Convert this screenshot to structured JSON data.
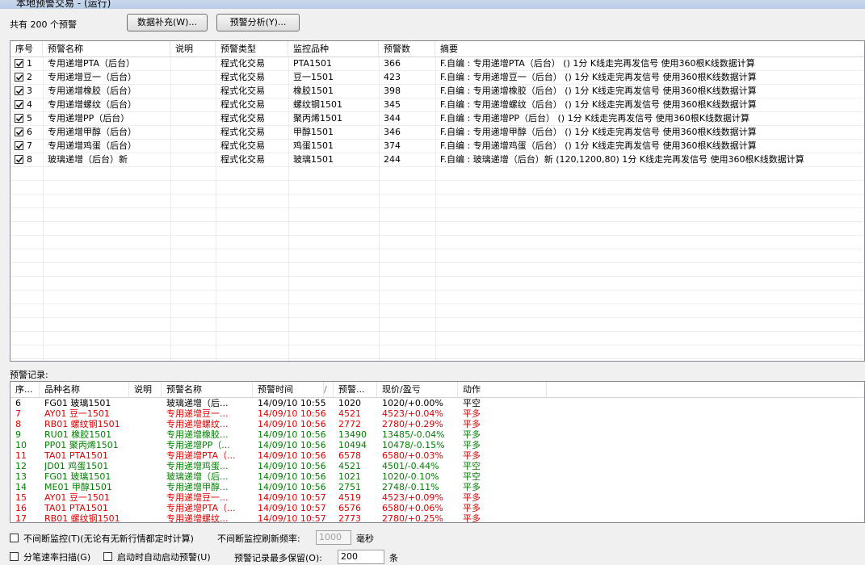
{
  "window": {
    "title": "本地预警交易 - (运行)"
  },
  "toolbar": {
    "count_text": "共有 200 个预警",
    "data_supplement_label": "数据补充(W)...",
    "alert_analysis_label": "预警分析(Y)..."
  },
  "alerts_table": {
    "columns": [
      "序号",
      "预警名称",
      "说明",
      "预警类型",
      "监控品种",
      "预警数",
      "摘要"
    ],
    "rows": [
      {
        "checked": true,
        "no": "1",
        "name": "专用递增PTA（后台）",
        "desc": "",
        "type": "程式化交易",
        "symbol": "PTA1501",
        "count": "366",
        "summary": "F.自编 : 专用递增PTA（后台） () 1分 K线走完再发信号 使用360根K线数据计算"
      },
      {
        "checked": true,
        "no": "2",
        "name": "专用递增豆一（后台）",
        "desc": "",
        "type": "程式化交易",
        "symbol": "豆一1501",
        "count": "423",
        "summary": "F.自编 : 专用递增豆一（后台） () 1分 K线走完再发信号 使用360根K线数据计算"
      },
      {
        "checked": true,
        "no": "3",
        "name": "专用递增橡胶（后台）",
        "desc": "",
        "type": "程式化交易",
        "symbol": "橡胶1501",
        "count": "398",
        "summary": "F.自编 : 专用递增橡胶（后台） () 1分 K线走完再发信号 使用360根K线数据计算"
      },
      {
        "checked": true,
        "no": "4",
        "name": "专用递增螺纹（后台）",
        "desc": "",
        "type": "程式化交易",
        "symbol": "螺纹钢1501",
        "count": "345",
        "summary": "F.自编 : 专用递增螺纹（后台） () 1分 K线走完再发信号 使用360根K线数据计算"
      },
      {
        "checked": true,
        "no": "5",
        "name": "专用递增PP（后台）",
        "desc": "",
        "type": "程式化交易",
        "symbol": "聚丙烯1501",
        "count": "344",
        "summary": "F.自编 : 专用递增PP（后台） () 1分 K线走完再发信号 使用360根K线数据计算"
      },
      {
        "checked": true,
        "no": "6",
        "name": "专用递增甲醇（后台）",
        "desc": "",
        "type": "程式化交易",
        "symbol": "甲醇1501",
        "count": "346",
        "summary": "F.自编 : 专用递增甲醇（后台） () 1分 K线走完再发信号 使用360根K线数据计算"
      },
      {
        "checked": true,
        "no": "7",
        "name": "专用递增鸡蛋（后台）",
        "desc": "",
        "type": "程式化交易",
        "symbol": "鸡蛋1501",
        "count": "374",
        "summary": "F.自编 : 专用递增鸡蛋（后台） () 1分 K线走完再发信号 使用360根K线数据计算"
      },
      {
        "checked": true,
        "no": "8",
        "name": "玻璃递增（后台）新",
        "desc": "",
        "type": "程式化交易",
        "symbol": "玻璃1501",
        "count": "244",
        "summary": "F.自编 : 玻璃递增（后台）新 (120,1200,80) 1分 K线走完再发信号 使用360根K线数据计算"
      }
    ]
  },
  "records": {
    "label": "预警记录:",
    "columns": [
      "序...",
      "品种名称",
      "说明",
      "预警名称",
      "预警时间",
      "/",
      "预警...",
      "现价/盈亏",
      "动作"
    ],
    "rows": [
      {
        "no": "6",
        "symbol": "FG01 玻璃1501",
        "desc": "",
        "name": "玻璃递增（后...",
        "time": "14/09/10 10:55",
        "price": "1020",
        "pnl": "1020/+0.00%",
        "action": "平空",
        "color": "#000000"
      },
      {
        "no": "7",
        "symbol": "AY01 豆一1501",
        "desc": "",
        "name": "专用递增豆一...",
        "time": "14/09/10 10:56",
        "price": "4521",
        "pnl": "4523/+0.04%",
        "action": "平多",
        "color": "#e00000"
      },
      {
        "no": "8",
        "symbol": "RB01 螺纹钢1501",
        "desc": "",
        "name": "专用递增螺纹...",
        "time": "14/09/10 10:56",
        "price": "2772",
        "pnl": "2780/+0.29%",
        "action": "平多",
        "color": "#e00000"
      },
      {
        "no": "9",
        "symbol": "RU01 橡胶1501",
        "desc": "",
        "name": "专用递增橡胶...",
        "time": "14/09/10 10:56",
        "price": "13490",
        "pnl": "13485/-0.04%",
        "action": "平多",
        "color": "#008000"
      },
      {
        "no": "10",
        "symbol": "PP01 聚丙烯1501",
        "desc": "",
        "name": "专用递增PP（...",
        "time": "14/09/10 10:56",
        "price": "10494",
        "pnl": "10478/-0.15%",
        "action": "平多",
        "color": "#008000"
      },
      {
        "no": "11",
        "symbol": "TA01 PTA1501",
        "desc": "",
        "name": "专用递增PTA（...",
        "time": "14/09/10 10:56",
        "price": "6578",
        "pnl": "6580/+0.03%",
        "action": "平多",
        "color": "#e00000"
      },
      {
        "no": "12",
        "symbol": "JD01 鸡蛋1501",
        "desc": "",
        "name": "专用递增鸡蛋...",
        "time": "14/09/10 10:56",
        "price": "4521",
        "pnl": "4501/-0.44%",
        "action": "平空",
        "color": "#008000"
      },
      {
        "no": "13",
        "symbol": "FG01 玻璃1501",
        "desc": "",
        "name": "玻璃递增（后...",
        "time": "14/09/10 10:56",
        "price": "1021",
        "pnl": "1020/-0.10%",
        "action": "平空",
        "color": "#008000"
      },
      {
        "no": "14",
        "symbol": "ME01 甲醇1501",
        "desc": "",
        "name": "专用递增甲醇...",
        "time": "14/09/10 10:56",
        "price": "2751",
        "pnl": "2748/-0.11%",
        "action": "平多",
        "color": "#008000"
      },
      {
        "no": "15",
        "symbol": "AY01 豆一1501",
        "desc": "",
        "name": "专用递增豆一...",
        "time": "14/09/10 10:57",
        "price": "4519",
        "pnl": "4523/+0.09%",
        "action": "平多",
        "color": "#e00000"
      },
      {
        "no": "16",
        "symbol": "TA01 PTA1501",
        "desc": "",
        "name": "专用递增PTA（...",
        "time": "14/09/10 10:57",
        "price": "6576",
        "pnl": "6580/+0.06%",
        "action": "平多",
        "color": "#e00000"
      },
      {
        "no": "17",
        "symbol": "RB01 螺纹钢1501",
        "desc": "",
        "name": "专用递增螺纹...",
        "time": "14/09/10 10:57",
        "price": "2773",
        "pnl": "2780/+0.25%",
        "action": "平多",
        "color": "#e00000"
      }
    ]
  },
  "options": {
    "continuous_monitor_label": "不间断监控(T)(无论有无新行情都定时计算)",
    "refresh_rate_label": "不间断监控刷新频率:",
    "refresh_rate_value": "1000",
    "refresh_unit": "毫秒",
    "tick_scan_label": "分笔速率扫描(G)",
    "autostart_label": "启动时自动启动预警(U)",
    "max_records_label": "预警记录最多保留(O):",
    "max_records_value": "200",
    "max_records_unit": "条"
  }
}
